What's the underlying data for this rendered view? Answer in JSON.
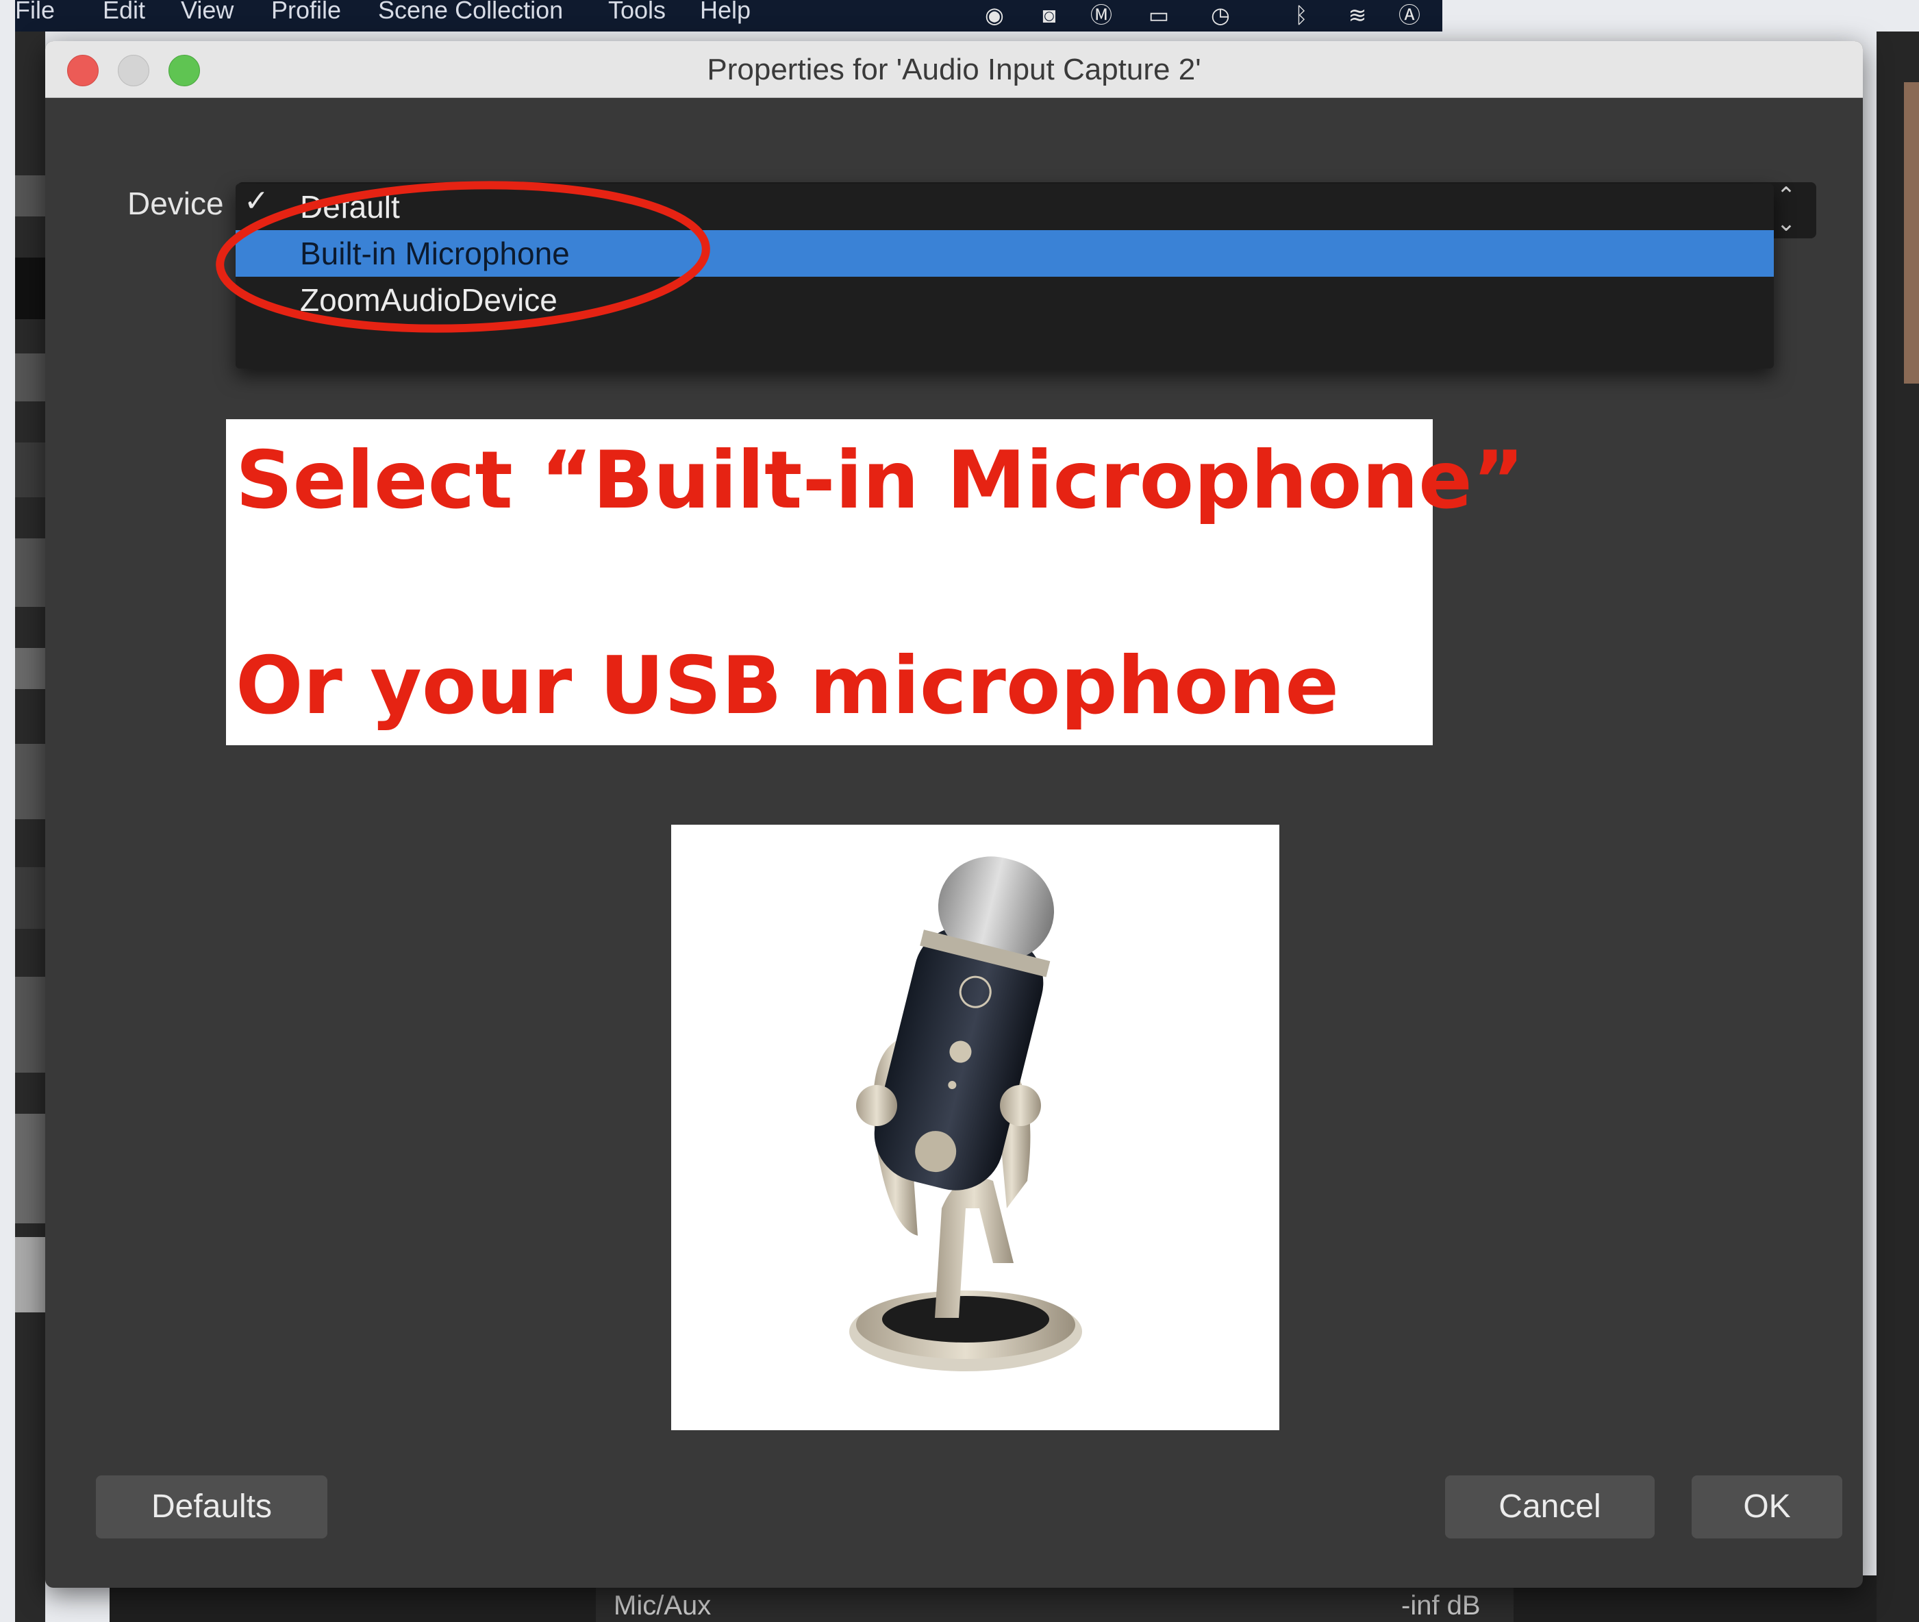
{
  "app_menu": [
    "File",
    "Edit",
    "View",
    "Profile",
    "Scene Collection",
    "Tools",
    "Help"
  ],
  "menubar_icons": [
    "github-icon",
    "facetime-icon",
    "malwarebytes-icon",
    "airplay-icon",
    "time-machine-icon",
    "bluetooth-icon",
    "wifi-icon",
    "input-source-icon"
  ],
  "dialog": {
    "title": "Properties for 'Audio Input Capture 2'",
    "device_label": "Device",
    "checkmark": "✓",
    "options": [
      "Default",
      "Built-in Microphone",
      "ZoomAudioDevice"
    ],
    "selected_option": "Built-in Microphone",
    "buttons": {
      "defaults": "Defaults",
      "cancel": "Cancel",
      "ok": "OK"
    }
  },
  "annotation": {
    "line1": "Select “Built-in Microphone”",
    "line2": "Or your USB microphone",
    "highlight_color": "#e62313"
  },
  "background_mixer": {
    "source": "Mic/Aux",
    "level": "-inf dB"
  },
  "colors": {
    "selection": "#3a82d6",
    "annotation_text": "#e62313",
    "dialog_bg": "#393939"
  }
}
